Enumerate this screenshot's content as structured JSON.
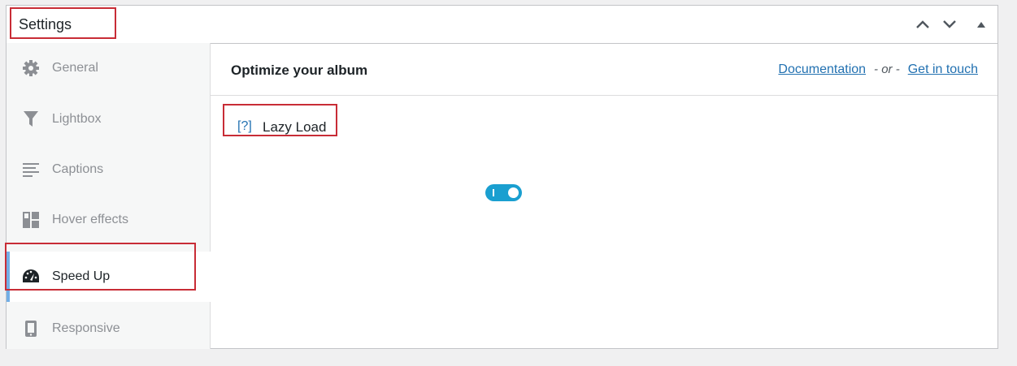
{
  "panel": {
    "title": "Settings",
    "controls": [
      "chevron-up-icon",
      "chevron-down-icon",
      "triangle-up-icon"
    ]
  },
  "sidebar": {
    "items": [
      {
        "label": "General",
        "icon": "gear-icon",
        "active": false
      },
      {
        "label": "Lightbox",
        "icon": "filter-icon",
        "active": false
      },
      {
        "label": "Captions",
        "icon": "text-lines-icon",
        "active": false
      },
      {
        "label": "Hover effects",
        "icon": "grid-layout-icon",
        "active": false
      },
      {
        "label": "Speed Up",
        "icon": "speedometer-icon",
        "active": true
      },
      {
        "label": "Responsive",
        "icon": "phone-icon",
        "active": false
      }
    ]
  },
  "content": {
    "title": "Optimize your album",
    "links": {
      "documentation": "Documentation",
      "separator": "- or -",
      "contact": "Get in touch"
    },
    "fields": [
      {
        "help": "[?]",
        "label": "Lazy Load",
        "enabled": true
      }
    ]
  },
  "colors": {
    "accent": "#72aee6",
    "toggle_on": "#1a9fd0",
    "highlight": "#c82c36",
    "link": "#2271b1"
  }
}
